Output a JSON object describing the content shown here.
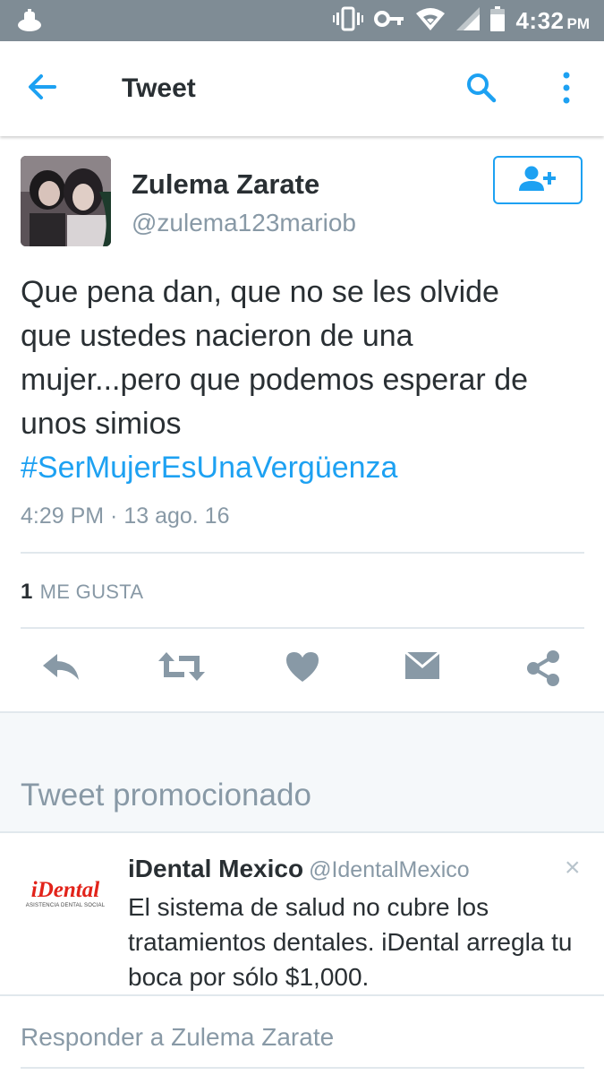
{
  "status_bar": {
    "time": "4:32",
    "ampm": "PM",
    "icons": [
      "app-notification-icon",
      "vibrate-icon",
      "vpn-key-icon",
      "wifi-icon",
      "signal-icon",
      "battery-icon"
    ]
  },
  "header": {
    "title": "Tweet",
    "icons": [
      "back-arrow-icon",
      "search-icon",
      "more-vert-icon"
    ]
  },
  "tweet": {
    "author_name": "Zulema Zarate",
    "author_handle": "@zulema123mariob",
    "text_lines": [
      "Que pena dan, que no se les olvide",
      "que ustedes nacieron de una",
      "mujer...pero que podemos esperar de",
      "unos simios"
    ],
    "hashtag": "#SerMujerEsUnaVergüenza",
    "timestamp": "4:29 PM · 13 ago. 16",
    "likes_count": "1",
    "likes_label": "ME GUSTA",
    "action_icons": [
      "reply-icon",
      "retweet-icon",
      "like-heart-icon",
      "direct-message-icon",
      "share-icon"
    ]
  },
  "promoted": {
    "section_label": "Tweet promocionado",
    "logo_text": "iDental",
    "logo_subtext": "ASISTENCIA DENTAL SOCIAL",
    "name": "iDental Mexico",
    "handle": "@IdentalMexico",
    "text": "El sistema de salud no cubre los tratamientos dentales. iDental arregla tu boca por sólo $1,000.",
    "close_symbol": "×"
  },
  "reply": {
    "placeholder": "Responder a Zulema Zarate"
  },
  "colors": {
    "accent": "#1da1f2",
    "status_bar": "#7f8c95",
    "secondary_text": "#8899a6",
    "icon_gray": "#8899a6"
  }
}
